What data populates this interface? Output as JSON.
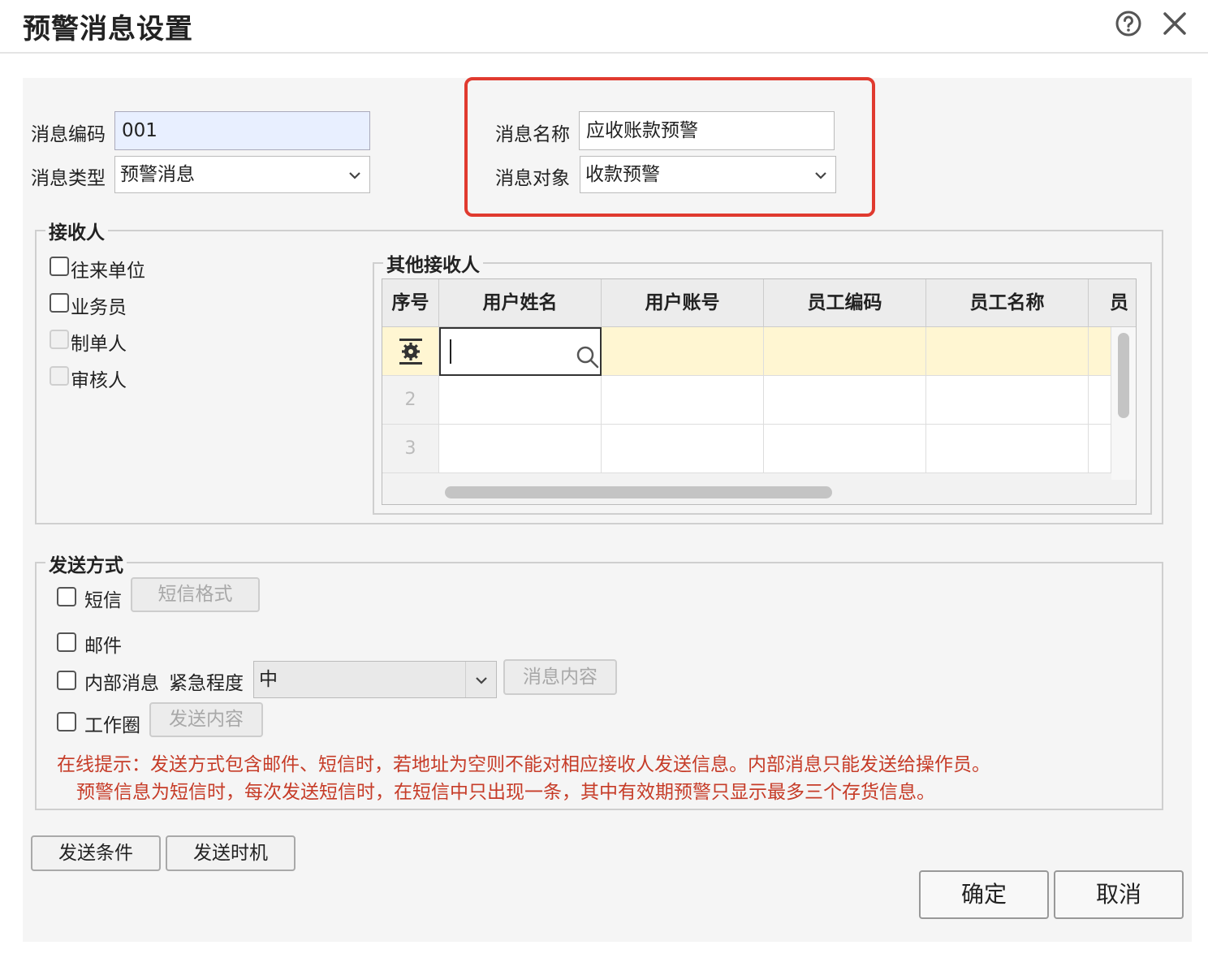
{
  "window": {
    "title": "预警消息设置",
    "help_icon": "help-circle-icon",
    "close_icon": "close-icon"
  },
  "form": {
    "code_label": "消息编码",
    "code_value": "001",
    "type_label": "消息类型",
    "type_value": "预警消息",
    "name_label": "消息名称",
    "name_value": "应收账款预警",
    "target_label": "消息对象",
    "target_value": "收款预警"
  },
  "receivers": {
    "legend": "接收人",
    "options": [
      {
        "label": "往来单位",
        "checked": false,
        "enabled": true
      },
      {
        "label": "业务员",
        "checked": false,
        "enabled": true
      },
      {
        "label": "制单人",
        "checked": false,
        "enabled": false
      },
      {
        "label": "审核人",
        "checked": false,
        "enabled": false
      }
    ]
  },
  "other_receivers": {
    "legend": "其他接收人",
    "columns": [
      "序号",
      "用户姓名",
      "用户账号",
      "员工编码",
      "员工名称",
      "员"
    ],
    "row_numbers": [
      "2",
      "3"
    ],
    "row_settings_icon": "gear-settings-icon",
    "search_icon": "search-icon"
  },
  "send_methods": {
    "legend": "发送方式",
    "sms_label": "短信",
    "sms_format_button": "短信格式",
    "email_label": "邮件",
    "internal_label": "内部消息",
    "urgency_label": "紧急程度",
    "urgency_value": "中",
    "message_content_button": "消息内容",
    "workcircle_label": "工作圈",
    "send_content_button": "发送内容",
    "tip_line1": "在线提示：发送方式包含邮件、短信时，若地址为空则不能对相应接收人发送信息。内部消息只能发送给操作员。",
    "tip_line2": "预警信息为短信时，每次发送短信时，在短信中只出现一条，其中有效期预警只显示最多三个存货信息。"
  },
  "buttons": {
    "send_condition": "发送条件",
    "send_timing": "发送时机",
    "ok": "确定",
    "cancel": "取消"
  },
  "colors": {
    "highlight": "#e03a2f",
    "tip": "#c63c28",
    "code_input_bg": "#e8efff",
    "active_row": "#fff6d2"
  }
}
